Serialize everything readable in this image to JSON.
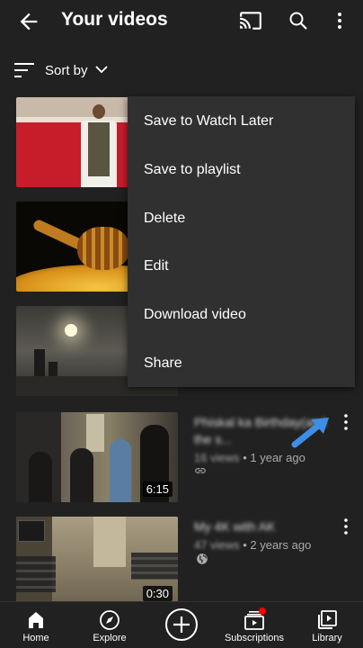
{
  "header": {
    "title": "Your videos",
    "icons": [
      "back-arrow-icon",
      "cast-icon",
      "search-icon",
      "more-vert-icon"
    ]
  },
  "sort": {
    "label": "Sort by"
  },
  "menu": {
    "items": [
      "Save to Watch Later",
      "Save to playlist",
      "Delete",
      "Edit",
      "Download video",
      "Share"
    ]
  },
  "videos": [
    {
      "title": "Phiskal ka Birthday(and the s...",
      "views": "16 views",
      "age": "1 year ago",
      "duration": "6:15",
      "visibility_icon": "link-icon"
    },
    {
      "title": "My 4K with AK",
      "views": "47 views",
      "age": "2 years ago",
      "duration": "0:30",
      "visibility_icon": "globe-icon"
    }
  ],
  "nav": {
    "items": [
      {
        "label": "Home",
        "icon": "home-icon"
      },
      {
        "label": "Explore",
        "icon": "compass-icon"
      },
      {
        "label": "",
        "icon": "create-plus-icon"
      },
      {
        "label": "Subscriptions",
        "icon": "subscriptions-icon"
      },
      {
        "label": "Library",
        "icon": "library-icon"
      }
    ]
  },
  "colors": {
    "background": "#212121",
    "menu": "#303030",
    "notification": "#ff0000",
    "arrow": "#3d8ee6"
  }
}
